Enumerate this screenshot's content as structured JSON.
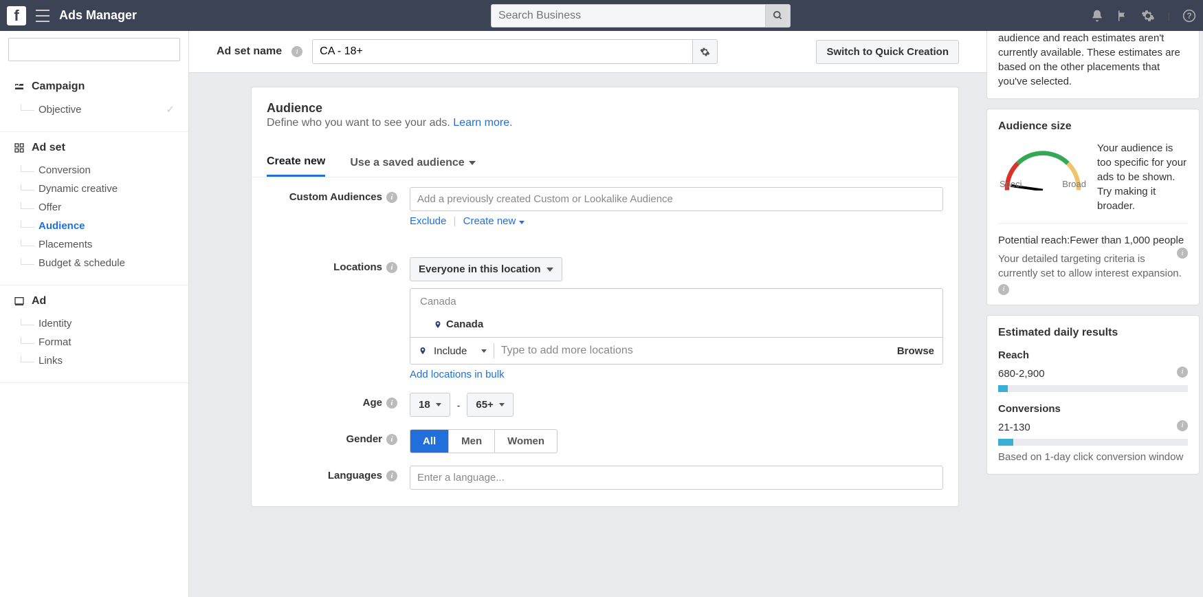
{
  "topbar": {
    "brand": "Ads Manager",
    "search_placeholder": "Search Business"
  },
  "header": {
    "label": "Ad set name",
    "value": "CA - 18+",
    "quick_creation": "Switch to Quick Creation"
  },
  "sidebar": {
    "campaign": {
      "heading": "Campaign",
      "items": [
        "Objective"
      ]
    },
    "adset": {
      "heading": "Ad set",
      "items": [
        "Conversion",
        "Dynamic creative",
        "Offer",
        "Audience",
        "Placements",
        "Budget & schedule"
      ],
      "active_index": 3
    },
    "ad": {
      "heading": "Ad",
      "items": [
        "Identity",
        "Format",
        "Links"
      ]
    }
  },
  "audience": {
    "title": "Audience",
    "subtitle": "Define who you want to see your ads. ",
    "learn_more": "Learn more.",
    "tabs": {
      "create_new": "Create new",
      "saved": "Use a saved audience"
    },
    "custom_audiences": {
      "label": "Custom Audiences",
      "placeholder": "Add a previously created Custom or Lookalike Audience",
      "exclude": "Exclude",
      "create_new": "Create new"
    },
    "locations": {
      "label": "Locations",
      "scope": "Everyone in this location",
      "country_group": "Canada",
      "selected": "Canada",
      "include": "Include",
      "more_placeholder": "Type to add more locations",
      "browse": "Browse",
      "bulk": "Add locations in bulk"
    },
    "age": {
      "label": "Age",
      "min": "18",
      "dash": "-",
      "max": "65+"
    },
    "gender": {
      "label": "Gender",
      "options": [
        "All",
        "Men",
        "Women"
      ],
      "active_index": 0
    },
    "languages": {
      "label": "Languages",
      "placeholder": "Enter a language..."
    }
  },
  "right": {
    "top_msg": "audience and reach estimates aren't currently available. These estimates are based on the other placements that you've selected.",
    "size": {
      "title": "Audience size",
      "specific": "Speci",
      "broad": "Broad",
      "message": "Your audience is too specific for your ads to be shown. Try making it broader.",
      "reach_label": "Potential reach:Fewer than 1,000 people",
      "criteria": "Your detailed targeting criteria is currently set to allow interest expansion."
    },
    "daily": {
      "title": "Estimated daily results",
      "reach_label": "Reach",
      "reach_value": "680-2,900",
      "conv_label": "Conversions",
      "conv_value": "21-130",
      "note": "Based on 1-day click conversion window"
    }
  }
}
